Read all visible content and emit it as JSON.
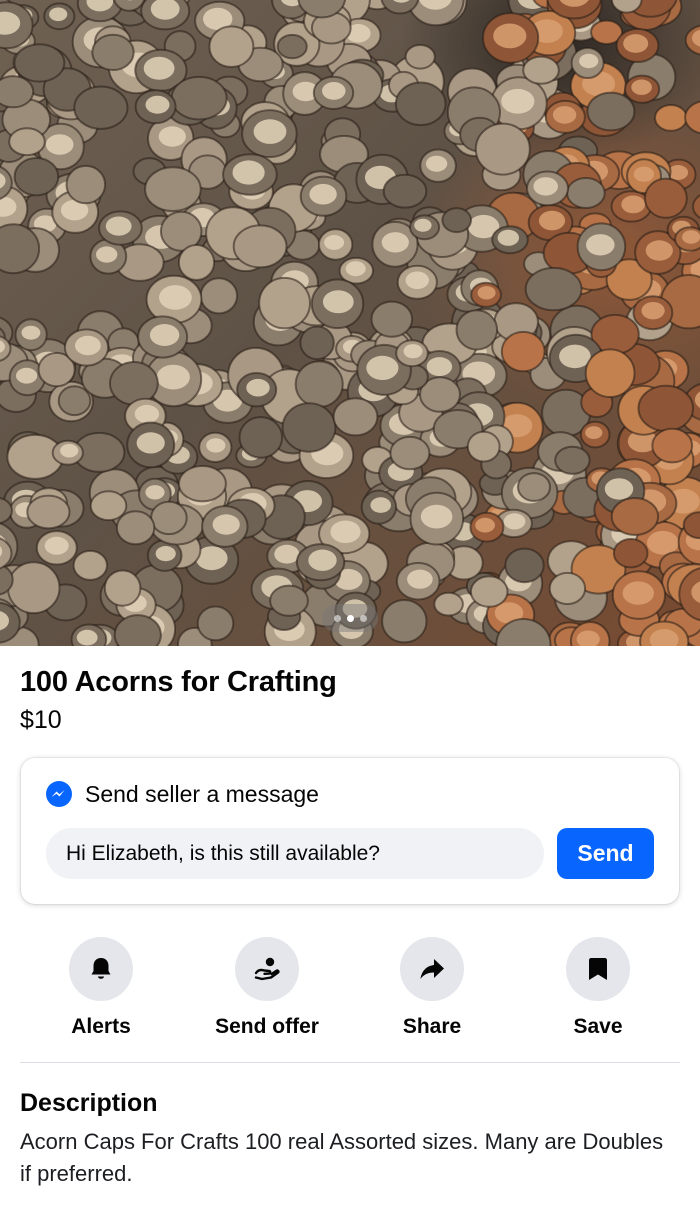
{
  "photo": {
    "icon": "acorn-caps-photo",
    "carousel_dots": 3,
    "active_dot": 1
  },
  "listing": {
    "title": "100 Acorns for Crafting",
    "price": "$10"
  },
  "message_card": {
    "heading": "Send seller a message",
    "input_value": "Hi Elizabeth, is this still available?",
    "send_label": "Send"
  },
  "actions": [
    {
      "label": "Alerts",
      "icon": "bell-icon"
    },
    {
      "label": "Send offer",
      "icon": "offer-icon"
    },
    {
      "label": "Share",
      "icon": "share-arrow-icon"
    },
    {
      "label": "Save",
      "icon": "bookmark-icon"
    }
  ],
  "description": {
    "heading": "Description",
    "text": "Acorn Caps For Crafts 100 real Assorted sizes. Many are Doubles if preferred."
  },
  "colors": {
    "accent": "#0866ff",
    "action_circle": "#e4e6eb",
    "input_bg": "#f0f2f5"
  }
}
